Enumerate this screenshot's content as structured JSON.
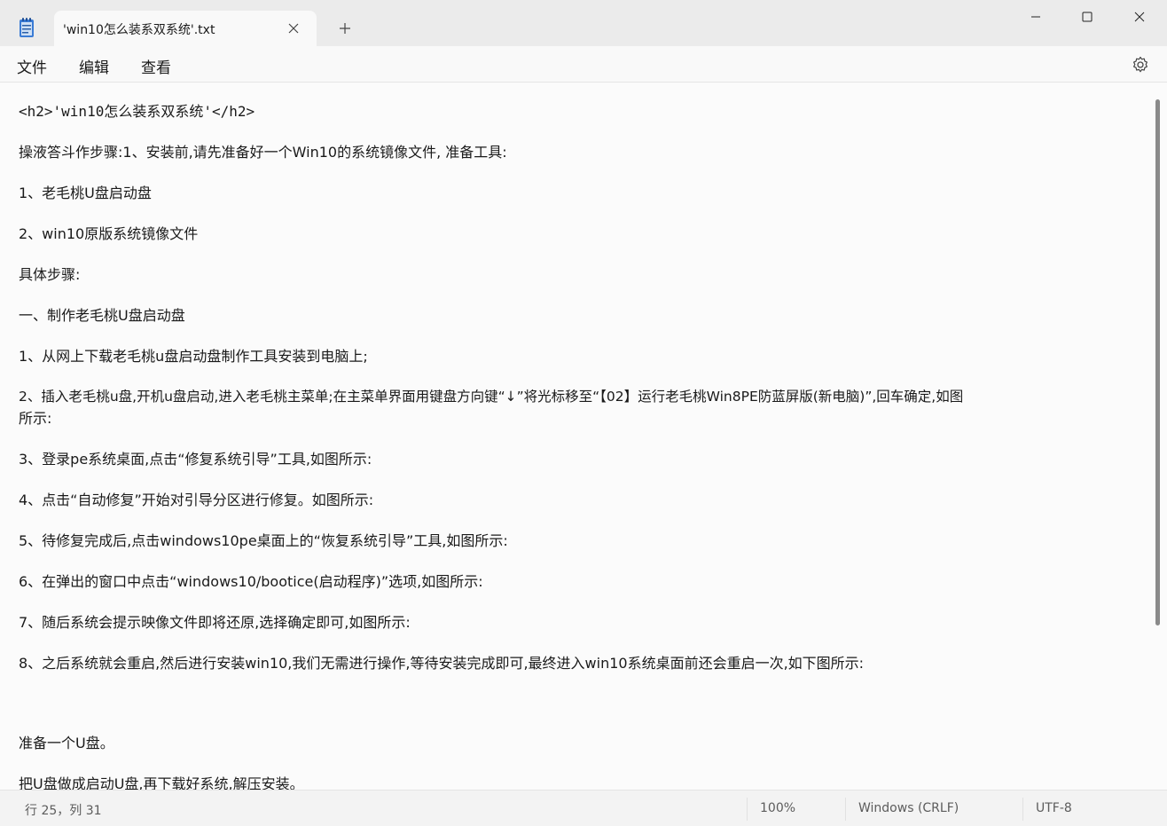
{
  "titlebar": {
    "tab_title": "'win10怎么装系双系统'.txt",
    "icons": [
      "notepad-icon",
      "close-icon",
      "plus-icon",
      "minimize-icon",
      "maximize-icon",
      "close-icon"
    ]
  },
  "menu": {
    "file": "文件",
    "edit": "编辑",
    "view": "查看"
  },
  "document": {
    "lines": [
      "<h2>'win10怎么装系双系统'</h2>",
      "操液答斗作步骤:1、安装前,请先准备好一个Win10的系统镜像文件, 准备工具:",
      "1、老毛桃U盘启动盘",
      "2、win10原版系统镜像文件",
      "具体步骤:",
      "一、制作老毛桃U盘启动盘",
      "1、从网上下载老毛桃u盘启动盘制作工具安装到电脑上;",
      "2、插入老毛桃u盘,开机u盘启动,进入老毛桃主菜单;在主菜单界面用键盘方向键“↓”将光标移至“【02】运行老毛桃Win8PE防蓝屏版(新电脑)”,回车确定,如图",
      "所示:",
      "3、登录pe系统桌面,点击“修复系统引导”工具,如图所示:",
      "4、点击“自动修复”开始对引导分区进行修复。如图所示:",
      "5、待修复完成后,点击windows10pe桌面上的“恢复系统引导”工具,如图所示:",
      "6、在弹出的窗口中点击“windows10/bootice(启动程序)”选项,如图所示:",
      "7、随后系统会提示映像文件即将还原,选择确定即可,如图所示:",
      "8、之后系统就会重启,然后进行安装win10,我们无需进行操作,等待安装完成即可,最终进入win10系统桌面前还会重启一次,如下图所示:",
      "准备一个U盘。",
      "把U盘做成启动U盘,再下载好系统,解压安装。"
    ]
  },
  "status": {
    "position": "行 25，列 31",
    "zoom": "100%",
    "line_ending": "Windows (CRLF)",
    "encoding": "UTF-8"
  },
  "colors": {
    "titlebar": "#ebebeb",
    "editor_bg": "#fbfbfb",
    "text": "#1a1a1a",
    "status_text": "#5c5c5c"
  }
}
